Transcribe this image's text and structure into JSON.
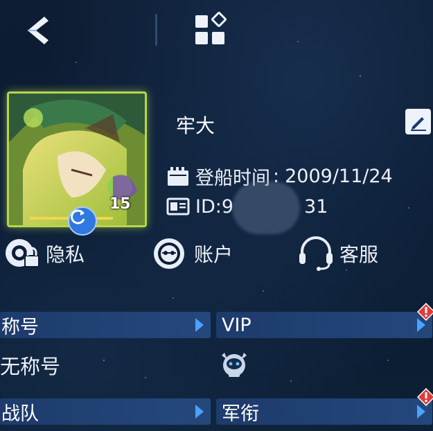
{
  "profile": {
    "name": "牢大",
    "join_label": "登船时间",
    "join_sep": ":",
    "join_date": "2009/11/24",
    "id_label": "ID:9",
    "id_suffix": "31",
    "level": "15"
  },
  "quick_actions": {
    "privacy": "隐私",
    "account": "账户",
    "service": "客服"
  },
  "sections": {
    "title_label": "称号",
    "title_value": "无称号",
    "vip_label": "VIP",
    "team_label": "战队",
    "rank_label": "军衔"
  },
  "icons": {
    "back": "back-chevron-icon",
    "apps": "apps-grid-icon",
    "edit": "edit-pencil-icon",
    "calendar": "calendar-icon",
    "id_card": "id-card-icon",
    "privacy": "privacy-lock-icon",
    "account": "account-icon",
    "service": "headset-icon",
    "refresh": "refresh-icon",
    "alert": "alert-icon",
    "mascot": "mascot-icon"
  },
  "colors": {
    "accent": "#4aa2ff",
    "bar": "#1e3c6e",
    "alert": "#e23a3a",
    "frame": "#b8d64a"
  }
}
